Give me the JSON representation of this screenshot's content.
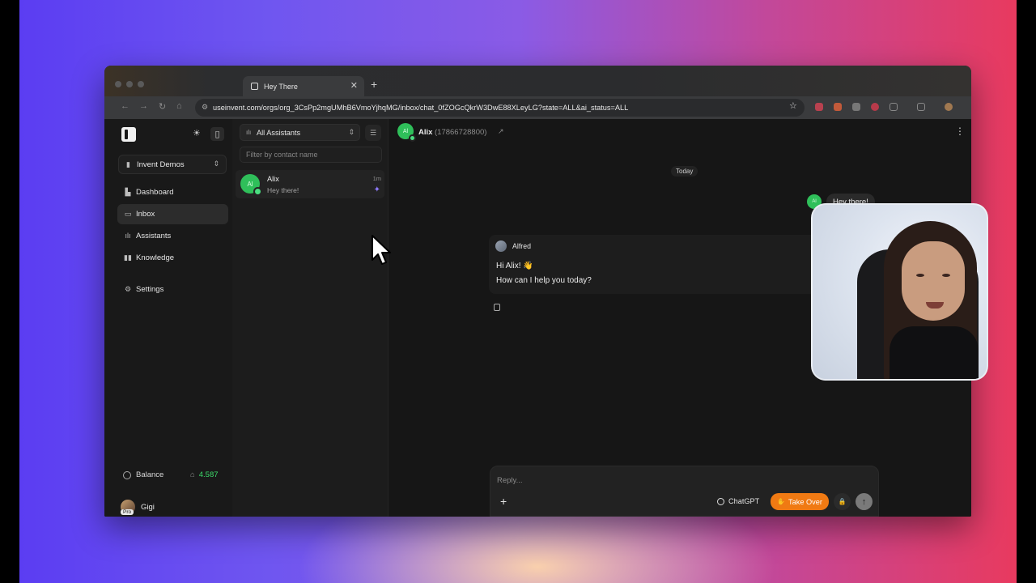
{
  "browser": {
    "tab_title": "Hey There",
    "url": "useinvent.com/orgs/org_3CsPp2mgUMhB6VmoYjhqMG/inbox/chat_0fZOGcQkrW3DwE88XLeyLG?state=ALL&ai_status=ALL"
  },
  "sidebar": {
    "org": "Invent Demos",
    "items": [
      {
        "label": "Dashboard",
        "icon": "dashboard-icon"
      },
      {
        "label": "Inbox",
        "icon": "inbox-icon"
      },
      {
        "label": "Assistants",
        "icon": "waveform-icon"
      },
      {
        "label": "Knowledge",
        "icon": "book-icon"
      },
      {
        "label": "Settings",
        "icon": "gear-icon"
      }
    ],
    "balance_label": "Balance",
    "balance_value": "4.587",
    "user_name": "Gigi",
    "plan_badge": "Pro"
  },
  "list": {
    "assistant_filter": "All Assistants",
    "search_placeholder": "Filter by contact name",
    "chats": [
      {
        "initials": "Al",
        "name": "Alix",
        "preview": "Hey there!",
        "time": "1m"
      }
    ]
  },
  "chat": {
    "contact_initials": "Al",
    "contact_name": "Alix",
    "contact_phone": "(17866728800)",
    "date_separator": "Today",
    "outgoing_initials": "Al",
    "outgoing_message": "Hey there!",
    "bot_name": "Alfred",
    "bot_line1": "Hi Alix! 👋",
    "bot_line2": "How can I help you today?",
    "reply_placeholder": "Reply...",
    "model_label": "ChatGPT",
    "takeover_label": "Take Over"
  },
  "colors": {
    "accent_orange": "#f07a13",
    "balance_green": "#3ddc6a",
    "avatar_green": "#2fbf5a"
  }
}
